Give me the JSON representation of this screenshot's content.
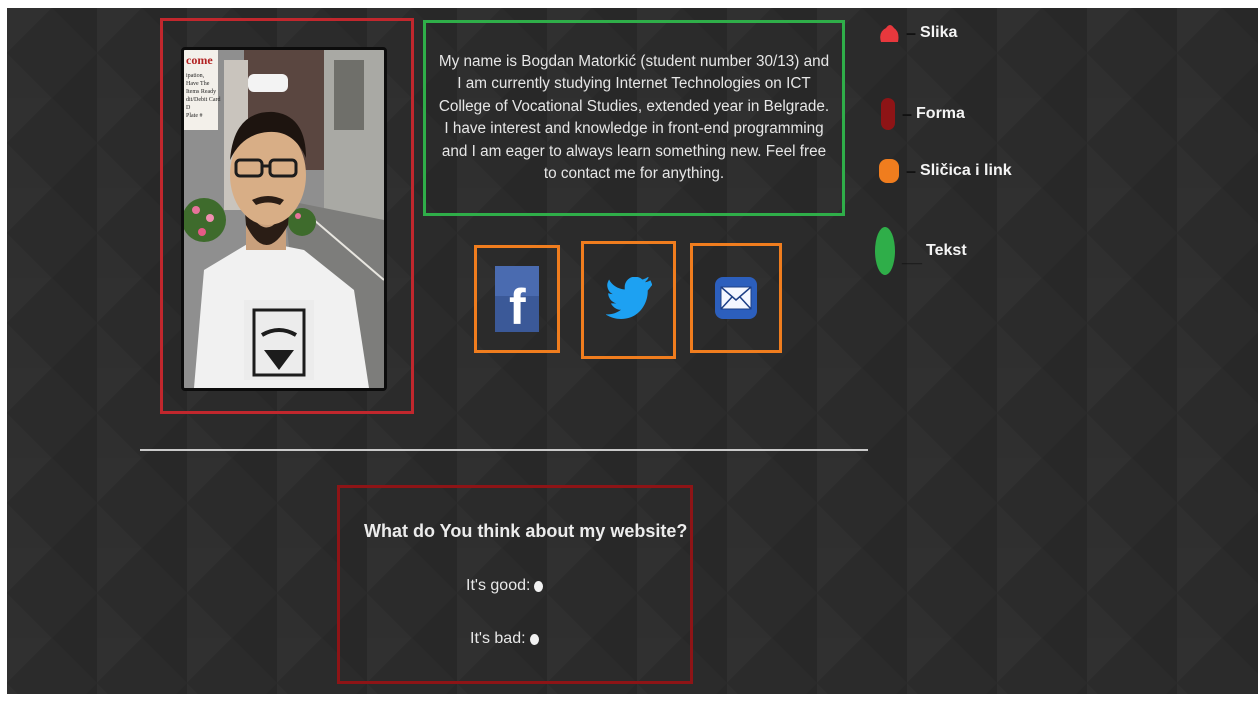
{
  "bio": {
    "text": "My name is Bogdan Matorkić (student number 30/13) and I am currently studying Internet Technologies on ICT College of Vocational Studies, extended year in Belgrade. I have interest and knowledge in front-end programming and I am eager to always learn something new. Feel free to contact me for anything."
  },
  "photo": {
    "sign_text": "come",
    "sign_small_text": [
      "ipation,",
      "Have The",
      "Items Ready",
      "dit/Debit Card",
      "D",
      "Plate #"
    ]
  },
  "social": [
    {
      "icon": "facebook-icon",
      "glyph": "f",
      "color": "#3b5998"
    },
    {
      "icon": "twitter-icon",
      "color": "#1da1f2"
    },
    {
      "icon": "mail-icon",
      "color": "#2c5fbd"
    }
  ],
  "form": {
    "question": "What do You think about my website?",
    "options": [
      {
        "label": "It's good:"
      },
      {
        "label": "It's bad:"
      }
    ]
  },
  "legend": [
    {
      "label": "Slika",
      "color": "#e8383d"
    },
    {
      "label": "Forma",
      "color": "#8e1416"
    },
    {
      "label": "Sličica i link",
      "color": "#f07d1e"
    },
    {
      "label": "Tekst",
      "color": "#2fae49"
    }
  ],
  "colors": {
    "background": "#2b2b2b",
    "photo_border": "#c1272d",
    "text_border": "#2fae49",
    "link_border": "#f07d1e",
    "form_border": "#8e1416"
  }
}
